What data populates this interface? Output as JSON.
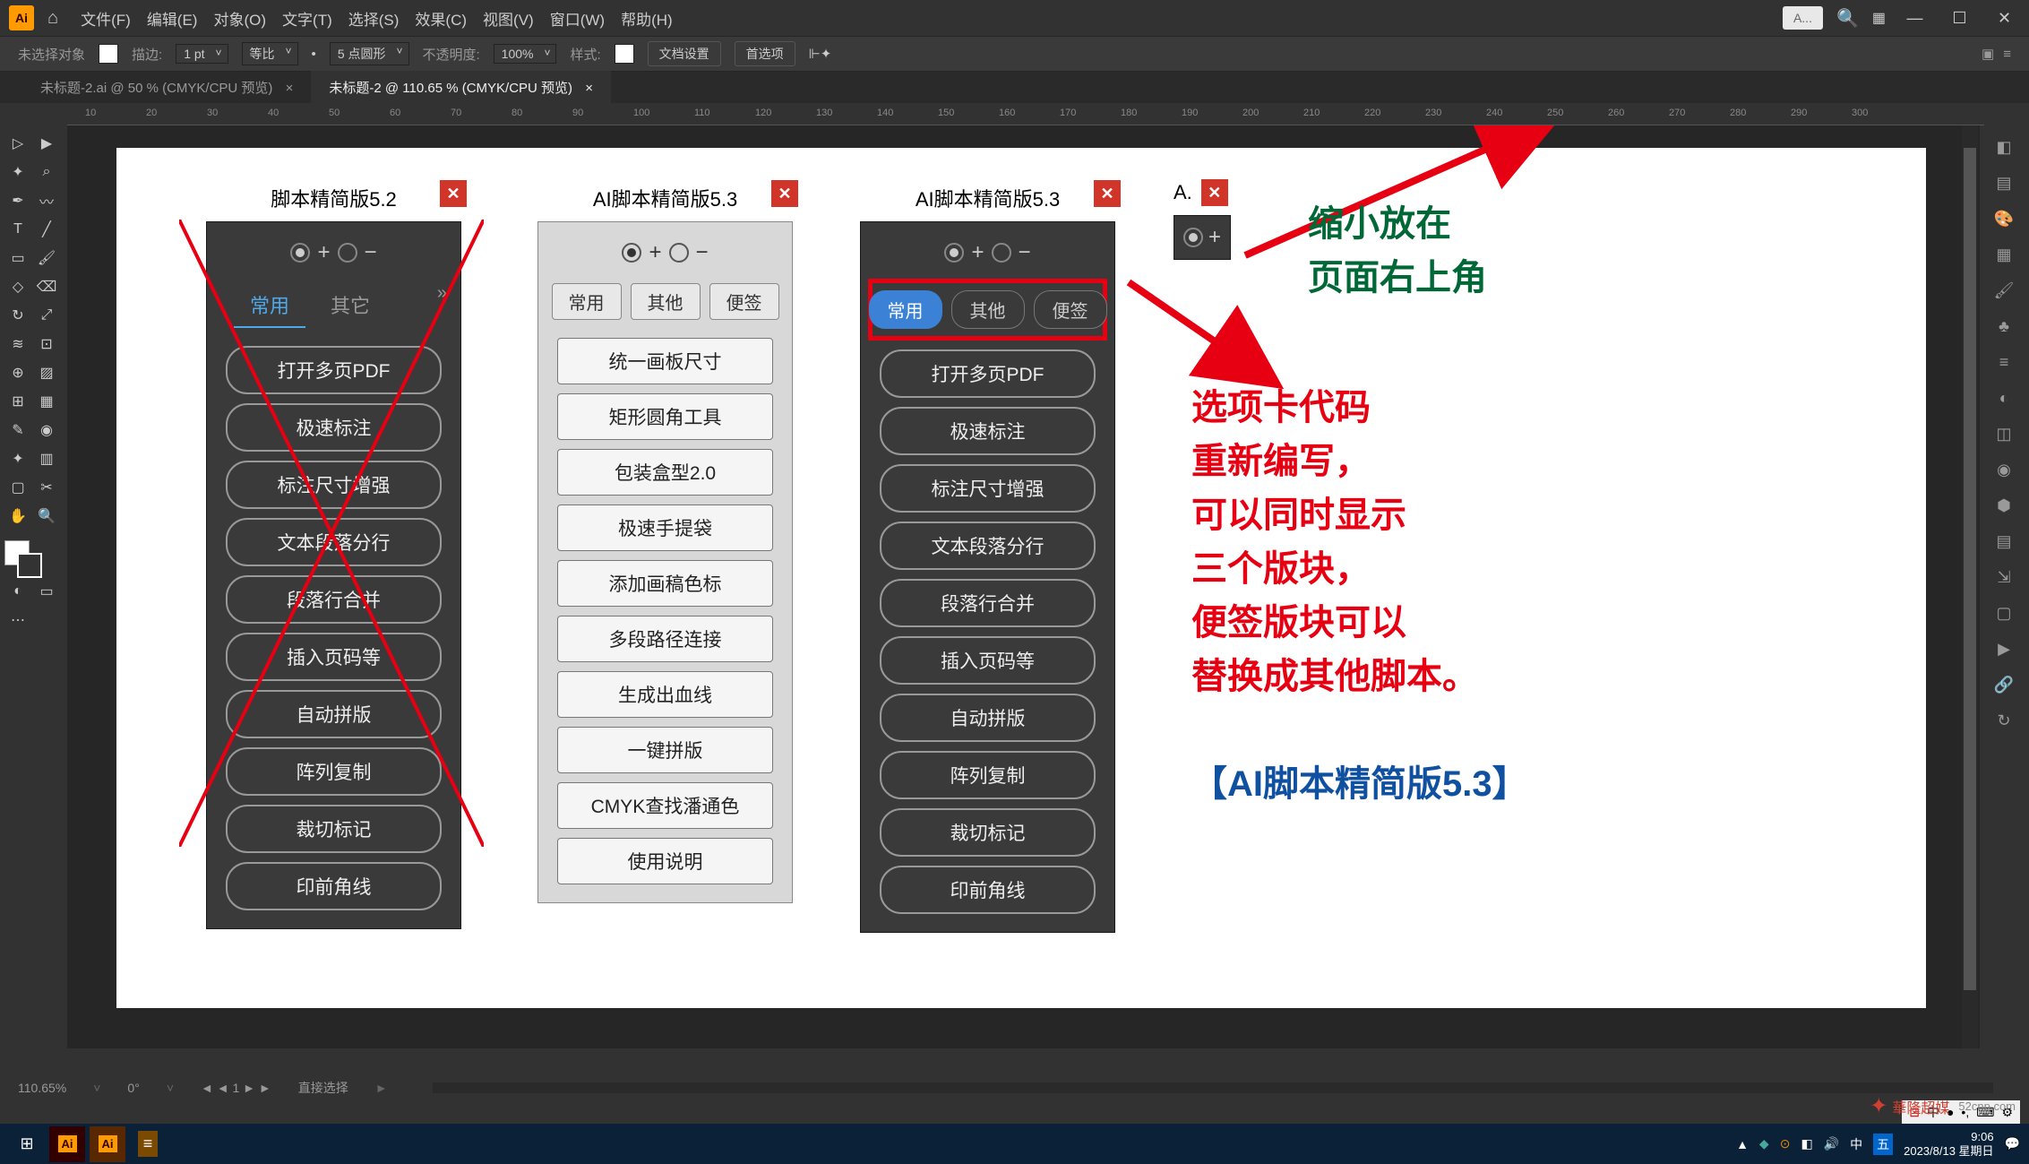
{
  "app": {
    "logo": "Ai"
  },
  "menu": {
    "items": [
      "文件(F)",
      "编辑(E)",
      "对象(O)",
      "文字(T)",
      "选择(S)",
      "效果(C)",
      "视图(V)",
      "窗口(W)",
      "帮助(H)"
    ]
  },
  "top_search": {
    "placeholder": "A..."
  },
  "control_bar": {
    "selection": "未选择对象",
    "stroke_label": "描边:",
    "stroke_value": "1 pt",
    "uniform": "等比",
    "style_label": "5 点圆形",
    "opacity_label": "不透明度:",
    "opacity_value": "100%",
    "style2": "样式:",
    "doc_setup": "文档设置",
    "prefs": "首选项"
  },
  "doc_tabs": [
    "未标题-2.ai @ 50 % (CMYK/CPU 预览)",
    "未标题-2 @ 110.65 % (CMYK/CPU 预览)"
  ],
  "panel52": {
    "title": "脚本精简版5.2",
    "tabs": [
      "常用",
      "其它"
    ],
    "buttons": [
      "打开多页PDF",
      "极速标注",
      "标注尺寸增强",
      "文本段落分行",
      "段落行合并",
      "插入页码等",
      "自动拼版",
      "阵列复制",
      "裁切标记",
      "印前角线"
    ]
  },
  "panel53_light": {
    "title": "AI脚本精简版5.3",
    "tabs": [
      "常用",
      "其他",
      "便签"
    ],
    "buttons": [
      "统一画板尺寸",
      "矩形圆角工具",
      "包装盒型2.0",
      "极速手提袋",
      "添加画稿色标",
      "多段路径连接",
      "生成出血线",
      "一键拼版",
      "CMYK查找潘通色",
      "使用说明"
    ]
  },
  "panel53_dark": {
    "title": "AI脚本精简版5.3",
    "tabs": [
      "常用",
      "其他",
      "便签"
    ],
    "buttons": [
      "打开多页PDF",
      "极速标注",
      "标注尺寸增强",
      "文本段落分行",
      "段落行合并",
      "插入页码等",
      "自动拼版",
      "阵列复制",
      "裁切标记",
      "印前角线"
    ]
  },
  "mini_panel": {
    "title": "A."
  },
  "annotations": {
    "top": "缩小放在\n页面右上角",
    "mid": "选项卡代码\n重新编写，\n可以同时显示\n三个版块，\n便签版块可以\n替换成其他脚本。",
    "bottom": "【AI脚本精简版5.3】"
  },
  "status": {
    "zoom": "110.65%",
    "angle": "0°",
    "artboard": "1",
    "tool": "直接选择"
  },
  "taskbar": {
    "time": "9:06",
    "date": "2023/8/13 星期日"
  },
  "watermark": "52cnp.com",
  "ruler_marks": [
    "10",
    "20",
    "30",
    "40",
    "50",
    "60",
    "70",
    "80",
    "90",
    "100",
    "110",
    "120",
    "130",
    "140",
    "150",
    "160",
    "170",
    "180",
    "190",
    "200",
    "210",
    "220",
    "230",
    "240",
    "250",
    "260",
    "270",
    "280",
    "290",
    "300"
  ]
}
